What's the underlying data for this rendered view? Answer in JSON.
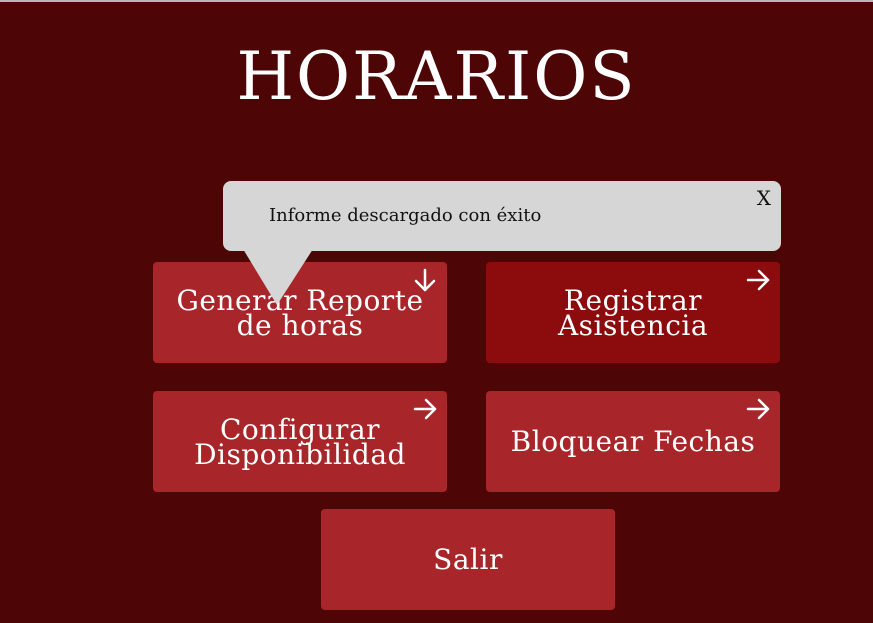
{
  "page": {
    "title": "HORARIOS"
  },
  "buttons": {
    "reporte": {
      "line1": "Generar Reporte",
      "line2": "de horas",
      "icon": "arrow-down-icon"
    },
    "registrar": {
      "line1": "Registrar",
      "line2": "Asistencia",
      "icon": "arrow-right-icon"
    },
    "configurar": {
      "line1": "Configurar",
      "line2": "Disponibilidad",
      "icon": "arrow-right-icon"
    },
    "bloquear": {
      "label": "Bloquear Fechas",
      "icon": "arrow-right-icon"
    },
    "salir": {
      "label": "Salir"
    }
  },
  "toast": {
    "message": "Informe descargado con éxito",
    "close_label": "X"
  },
  "colors": {
    "background": "#4d0506",
    "button": "#a8262a",
    "button_active": "#8c0b0d",
    "toast": "#d6d6d6"
  }
}
